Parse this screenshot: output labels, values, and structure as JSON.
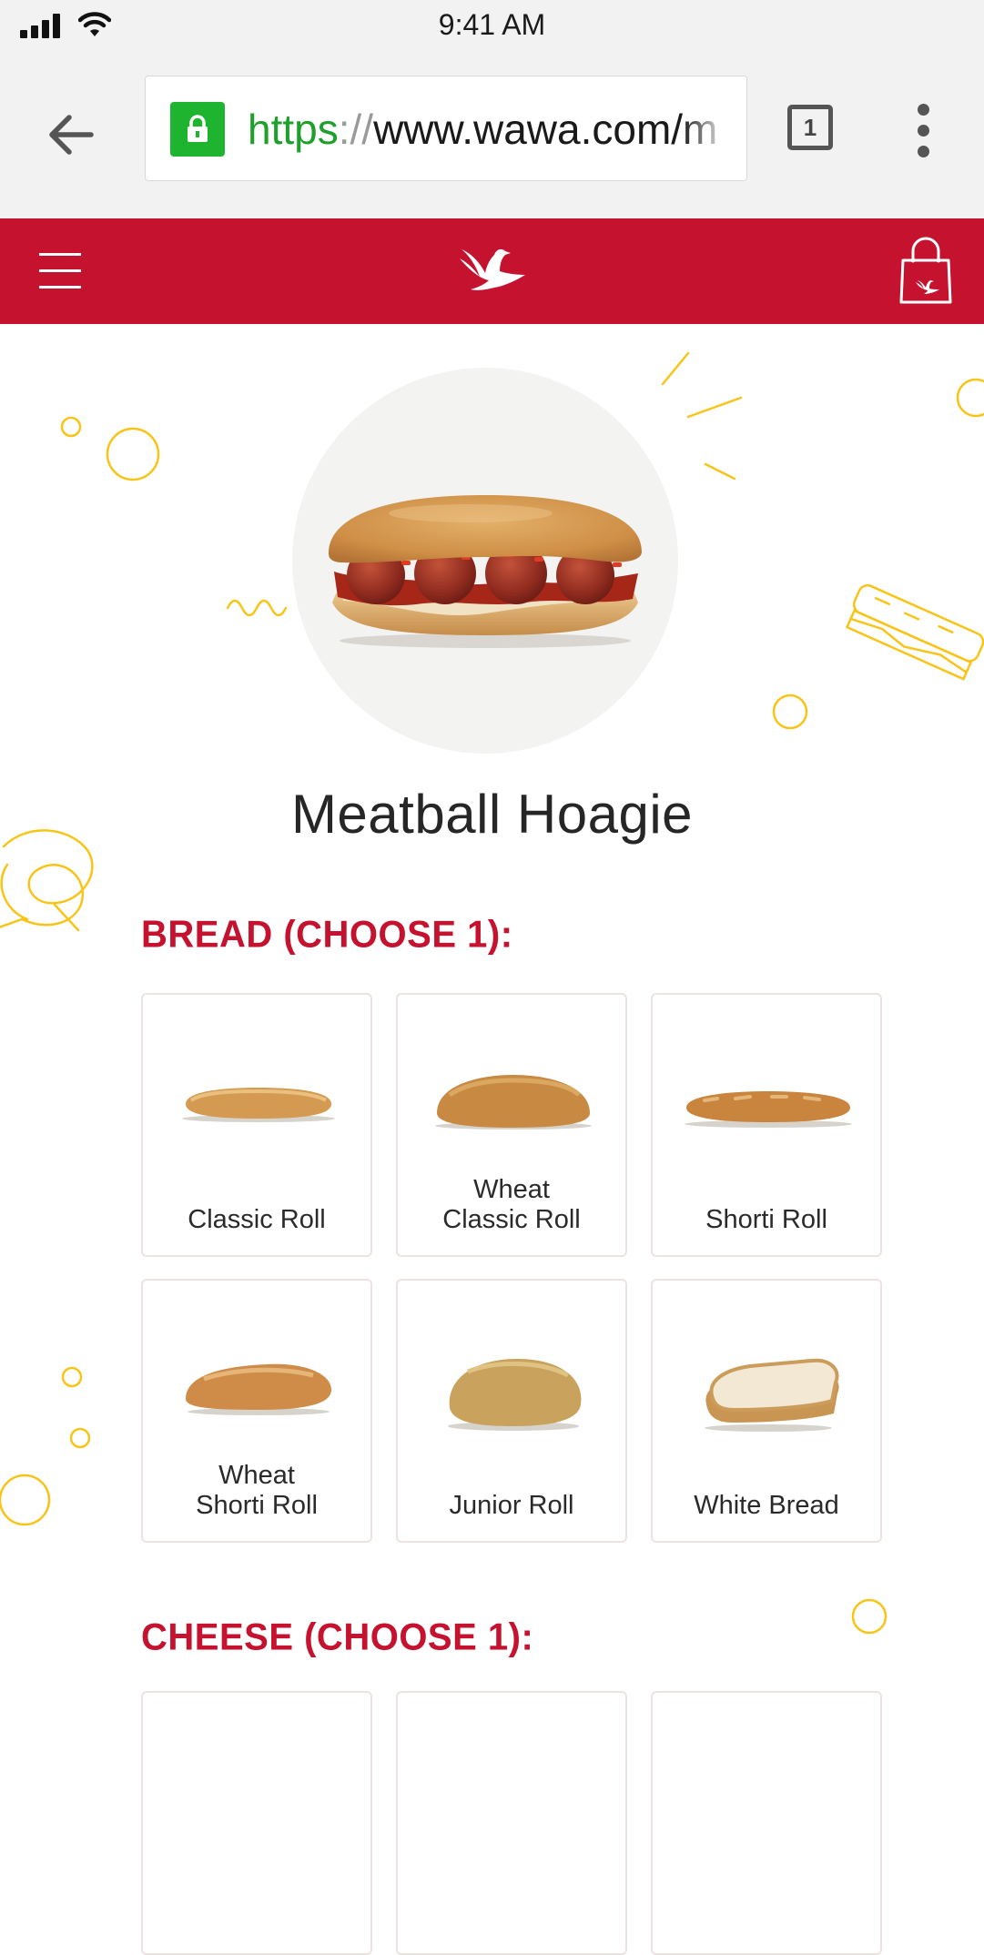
{
  "status_bar": {
    "time": "9:41 AM"
  },
  "browser": {
    "url_scheme": "https",
    "url_separator": "://",
    "url_host": "www.wawa.com/m",
    "tab_count": "1"
  },
  "header": {
    "brand_color": "#c4122f"
  },
  "product": {
    "title": "Meatball Hoagie"
  },
  "bread_section": {
    "heading": "BREAD (CHOOSE 1):",
    "options": [
      {
        "label": "Classic Roll"
      },
      {
        "label": "Wheat\nClassic Roll"
      },
      {
        "label": "Shorti Roll"
      },
      {
        "label": "Wheat\nShorti Roll"
      },
      {
        "label": "Junior Roll"
      },
      {
        "label": "White Bread"
      }
    ]
  },
  "cheese_section": {
    "heading": "CHEESE (CHOOSE 1):"
  },
  "colors": {
    "accent": "#c4122f",
    "decoration": "#f7c417",
    "secure": "#1fb42f"
  }
}
